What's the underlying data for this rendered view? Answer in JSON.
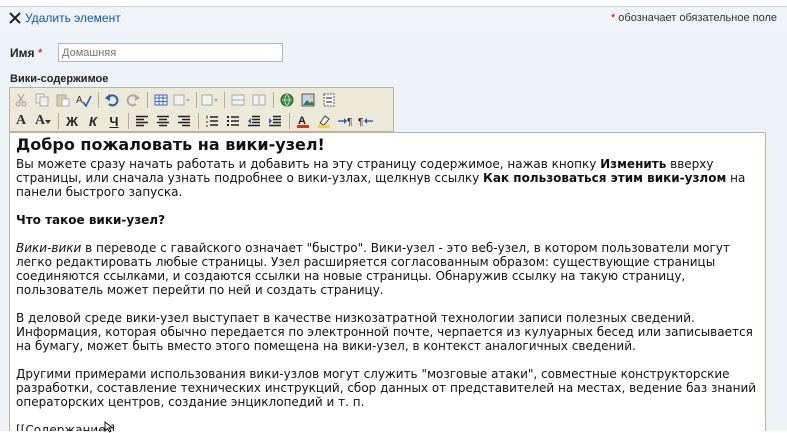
{
  "topbar": {
    "delete_label": "Удалить элемент",
    "required_star": "*",
    "required_note": "обозначает обязательное поле"
  },
  "name_field": {
    "label": "Имя",
    "required_star": "*",
    "placeholder": "Домашняя"
  },
  "wiki_label": "Вики-содержимое",
  "toolbar": {
    "row1": [
      "cut-icon",
      "copy-icon",
      "paste-icon",
      "spellcheck-icon",
      "undo-icon",
      "redo-icon",
      "insert-table-icon",
      "table-props-icon",
      "cell-props-icon",
      "merge-cells-icon",
      "split-cells-icon",
      "insert-link-icon",
      "insert-image-icon",
      "webpart-icon"
    ],
    "row2_text": {
      "font": "A",
      "size": "A",
      "bold": "Ж",
      "italic": "К",
      "underline": "Ч"
    }
  },
  "content": {
    "title": "Добро пожаловать на вики-узел!",
    "p1_a": "Вы можете сразу начать работать и добавить на эту страницу содержимое, нажав кнопку ",
    "p1_b": "Изменить",
    "p1_c": " вверху страницы, или сначала узнать подробнее о вики-узлах, щелкнув ссылку ",
    "p1_d": "Как пользоваться этим вики-узлом",
    "p1_e": " на панели быстрого запуска.",
    "h2": "Что такое вики-узел?",
    "p2_a": "Вики-вики",
    "p2_b": " в переводе с гавайского означает \"быстро\". Вики-узел - это веб-узел, в котором пользователи могут легко редактировать любые страницы. Узел расширяется согласованным образом: существующие страницы соединяются ссылками, и создаются ссылки на новые страницы. Обнаружив ссылку на такую страницу, пользователь может перейти по ней и создать страницу.",
    "p3": "В деловой среде вики-узел выступает в качестве низкозатратной технологии записи полезных сведений. Информация, которая обычно передается по электронной почте, черпается из кулуарных бесед или записывается на бумагу, может быть вместо этого помещена на вики-узел, в контекст аналогичных сведений.",
    "p4": "Другими примерами использования вики-узлов могут служить \"мозговые атаки\", совместные конструкторские разработки, составление технических инструкций, сбор данных от представителей на местах, ведение баз знаний операторских центров, создание энциклопедий и т. п.",
    "p5": "[[Содержание]]"
  }
}
